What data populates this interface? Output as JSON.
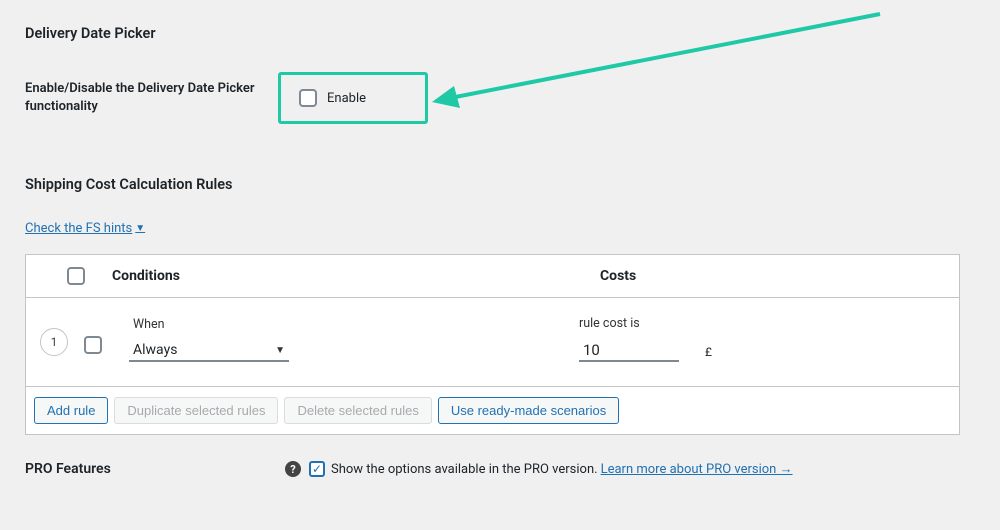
{
  "section": {
    "title": "Delivery Date Picker",
    "enable_row_label": "Enable/Disable the Delivery Date Picker functionality",
    "enable_checkbox_label": "Enable"
  },
  "rules": {
    "heading": "Shipping Cost Calculation Rules",
    "hints_link": "Check the FS hints",
    "columns": {
      "conditions": "Conditions",
      "costs": "Costs"
    },
    "rows": [
      {
        "index": "1",
        "when_label": "When",
        "when_value": "Always",
        "cost_label": "rule cost is",
        "cost_value": "10",
        "currency": "£"
      }
    ],
    "buttons": {
      "add": "Add rule",
      "duplicate": "Duplicate selected rules",
      "delete": "Delete selected rules",
      "scenarios": "Use ready-made scenarios"
    }
  },
  "pro": {
    "label": "PRO Features",
    "text": "Show the options available in the PRO version.",
    "link": "Learn more about PRO version →"
  }
}
